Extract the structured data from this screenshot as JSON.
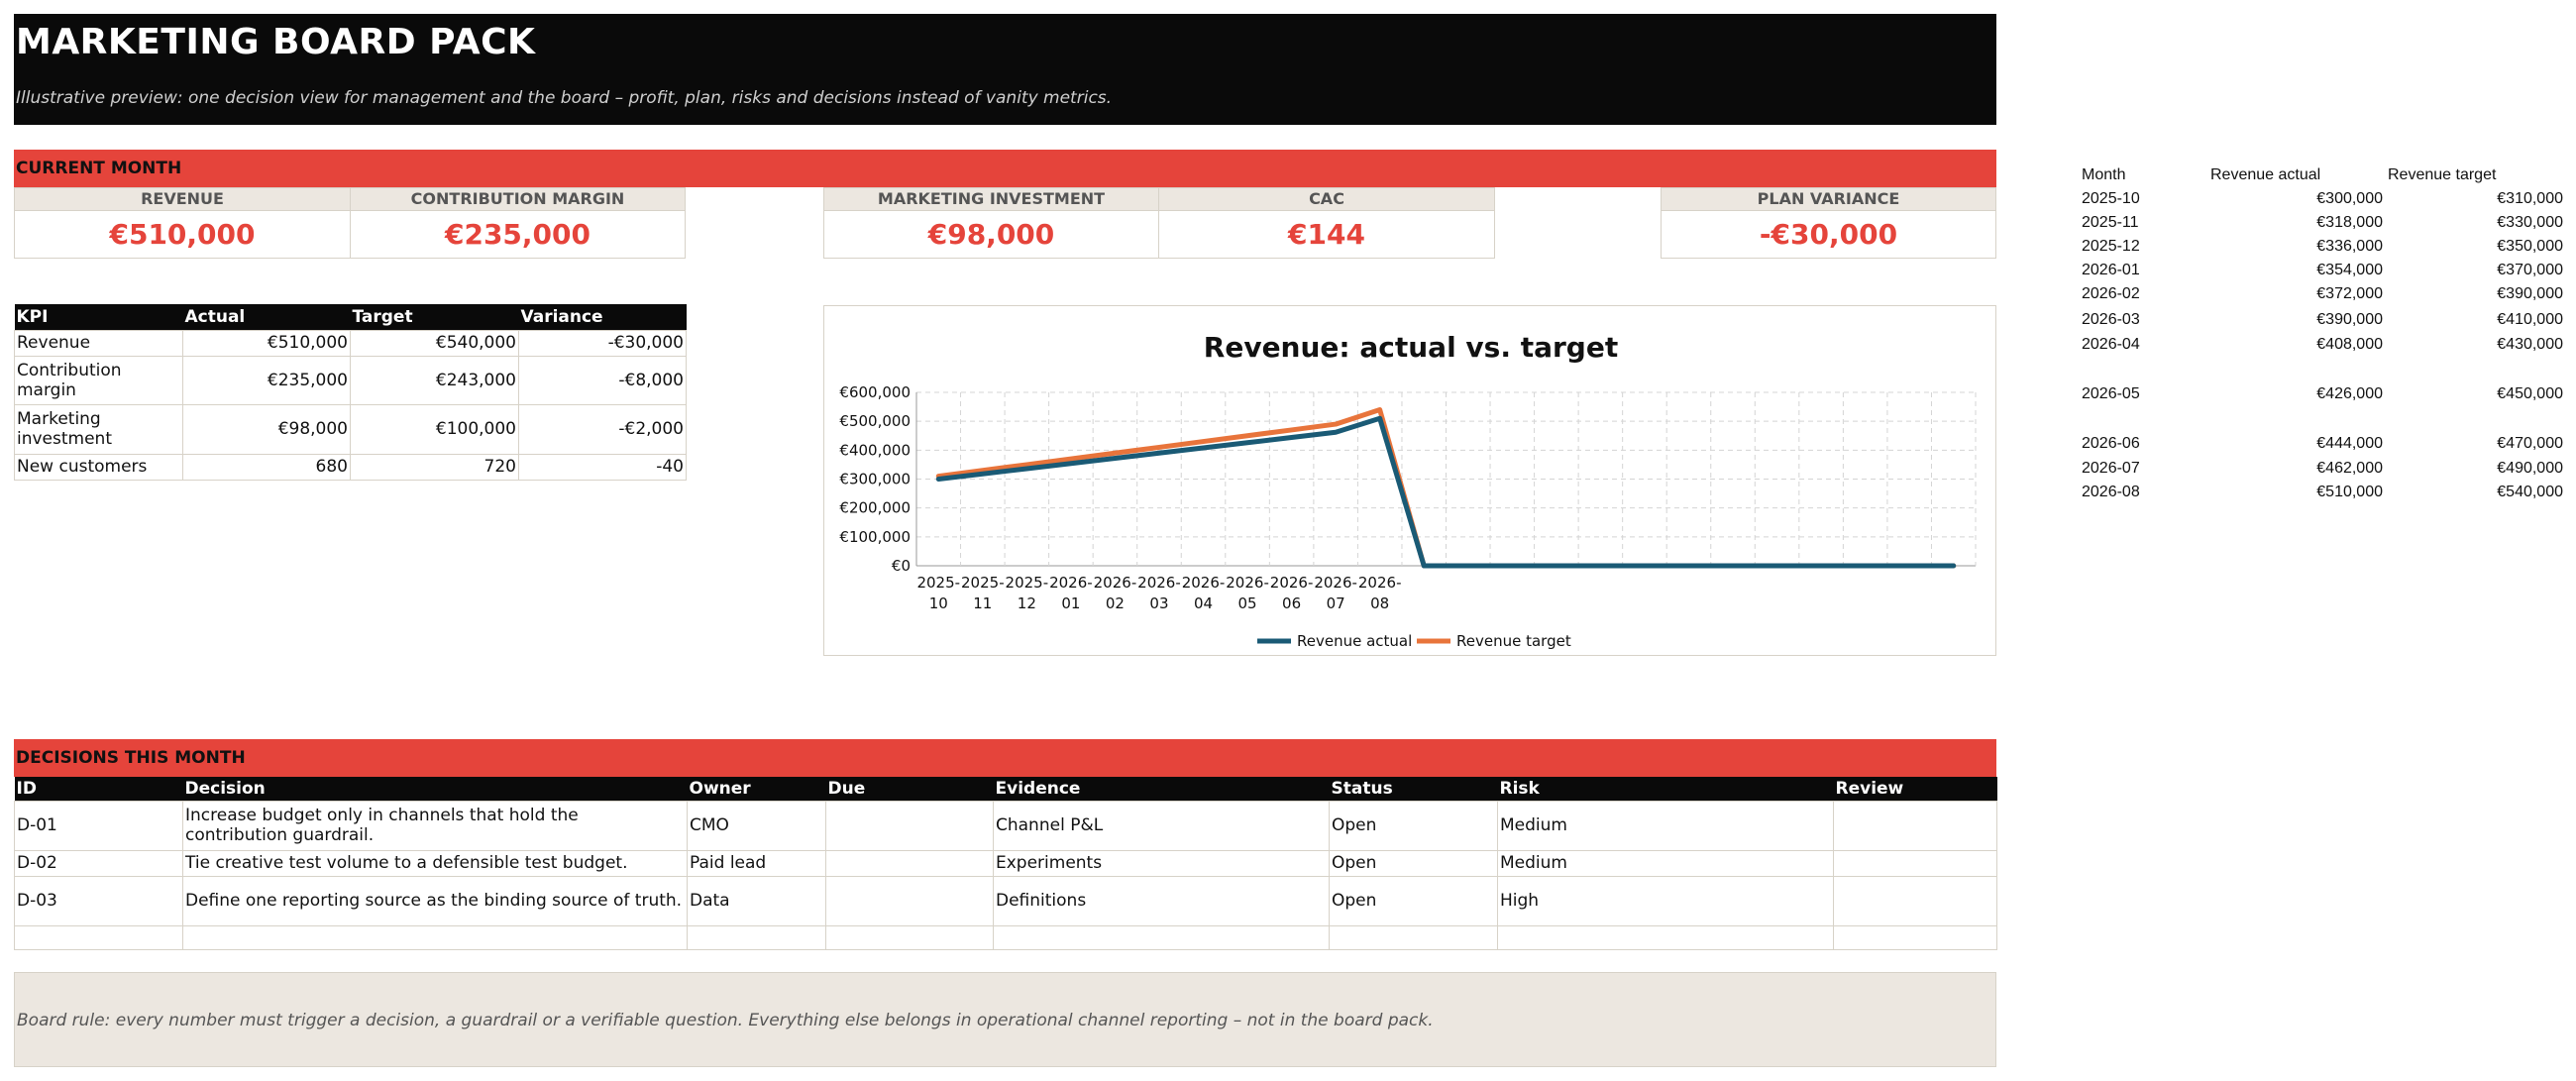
{
  "header": {
    "title": "MARKETING BOARD PACK",
    "subtitle": "Illustrative preview: one decision view for management and the board – profit, plan, risks and decisions instead of vanity metrics."
  },
  "current_month": {
    "title": "CURRENT MONTH",
    "cards": [
      {
        "label": "REVENUE",
        "value": "€510,000"
      },
      {
        "label": "CONTRIBUTION MARGIN",
        "value": "€235,000"
      },
      {
        "label": "MARKETING INVESTMENT",
        "value": "€98,000"
      },
      {
        "label": "CAC",
        "value": "€144"
      },
      {
        "label": "PLAN VARIANCE",
        "value": "-€30,000"
      }
    ]
  },
  "kpi_table": {
    "headers": [
      "KPI",
      "Actual",
      "Target",
      "Variance"
    ],
    "rows": [
      [
        "Revenue",
        "€510,000",
        "€540,000",
        "-€30,000"
      ],
      [
        "Contribution margin",
        "€235,000",
        "€243,000",
        "-€8,000"
      ],
      [
        "Marketing investment",
        "€98,000",
        "€100,000",
        "-€2,000"
      ],
      [
        "New customers",
        "680",
        "720",
        "-40"
      ]
    ]
  },
  "chart_data": {
    "type": "line",
    "title": "Revenue: actual vs. target",
    "xlabel": "",
    "ylabel": "",
    "categories": [
      "2025-10",
      "2025-11",
      "2025-12",
      "2026-01",
      "2026-02",
      "2026-03",
      "2026-04",
      "2026-05",
      "2026-06",
      "2026-07",
      "2026-08"
    ],
    "empty_categories_after": 13,
    "series": [
      {
        "name": "Revenue actual",
        "color": "#1a5a75",
        "values": [
          300000,
          318000,
          336000,
          354000,
          372000,
          390000,
          408000,
          426000,
          444000,
          462000,
          510000
        ]
      },
      {
        "name": "Revenue target",
        "color": "#e8743b",
        "values": [
          310000,
          330000,
          350000,
          370000,
          390000,
          410000,
          430000,
          450000,
          470000,
          490000,
          540000
        ]
      }
    ],
    "ylim": [
      0,
      600000
    ],
    "yticks": [
      "€0",
      "€100,000",
      "€200,000",
      "€300,000",
      "€400,000",
      "€500,000",
      "€600,000"
    ],
    "grid": true,
    "legend": "bottom"
  },
  "side_table": {
    "headers": [
      "Month",
      "Revenue actual",
      "Revenue target"
    ],
    "rows": [
      [
        "2025-10",
        "€300,000",
        "€310,000"
      ],
      [
        "2025-11",
        "€318,000",
        "€330,000"
      ],
      [
        "2025-12",
        "€336,000",
        "€350,000"
      ],
      [
        "2026-01",
        "€354,000",
        "€370,000"
      ],
      [
        "2026-02",
        "€372,000",
        "€390,000"
      ],
      [
        "2026-03",
        "€390,000",
        "€410,000"
      ],
      [
        "2026-04",
        "€408,000",
        "€430,000"
      ],
      [
        "2026-05",
        "€426,000",
        "€450,000"
      ],
      [
        "2026-06",
        "€444,000",
        "€470,000"
      ],
      [
        "2026-07",
        "€462,000",
        "€490,000"
      ],
      [
        "2026-08",
        "€510,000",
        "€540,000"
      ]
    ]
  },
  "decisions": {
    "title": "DECISIONS THIS MONTH",
    "headers": [
      "ID",
      "Decision",
      "Owner",
      "Due",
      "Evidence",
      "Status",
      "Risk",
      "Review"
    ],
    "rows": [
      [
        "D-01",
        "Increase budget only in channels that hold the contribution guardrail.",
        "CMO",
        "",
        "Channel P&L",
        "Open",
        "Medium",
        ""
      ],
      [
        "D-02",
        "Tie creative test volume to a defensible test budget.",
        "Paid lead",
        "",
        "Experiments",
        "Open",
        "Medium",
        ""
      ],
      [
        "D-03",
        "Define one reporting source as the binding source of truth.",
        "Data",
        "",
        "Definitions",
        "Open",
        "High",
        ""
      ]
    ]
  },
  "note": "Board rule: every number must trigger a decision, a guardrail or a verifiable question. Everything else belongs in operational channel reporting – not in the board pack."
}
